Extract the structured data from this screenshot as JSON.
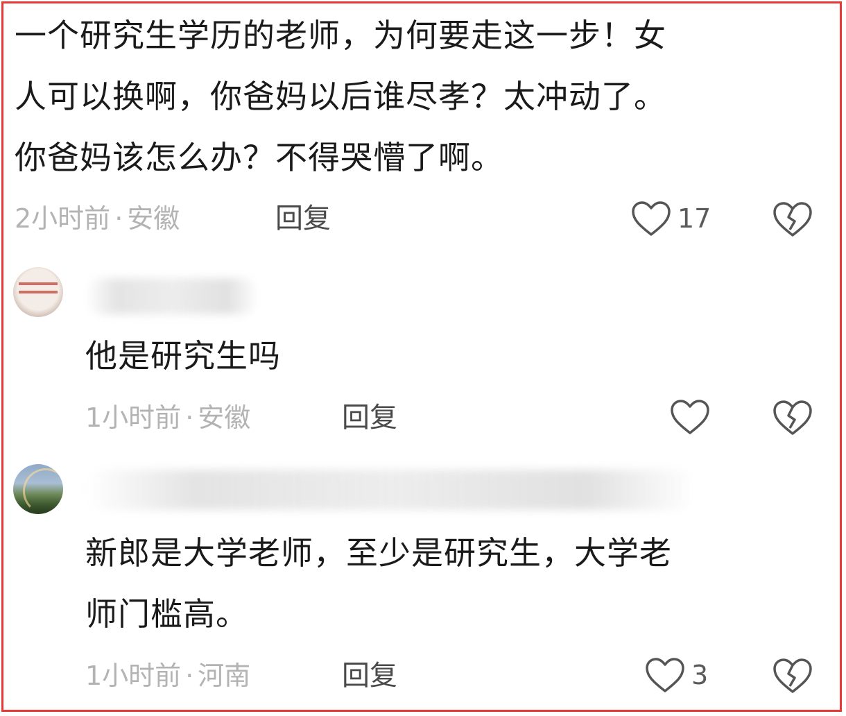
{
  "comments": [
    {
      "lines": [
        "一个研究生学历的老师，为何要走这一步！女",
        "人可以换啊，你爸妈以后谁尽孝？太冲动了。",
        "你爸妈该怎么办？不得哭懵了啊。"
      ],
      "time": "2小时前",
      "location": "安徽",
      "reply_label": "回复",
      "likes": "17"
    },
    {
      "lines": [
        "他是研究生吗"
      ],
      "time": "1小时前",
      "location": "安徽",
      "reply_label": "回复",
      "likes": ""
    },
    {
      "lines": [
        "新郎是大学老师，至少是研究生，大学老",
        "师门槛高。"
      ],
      "time": "1小时前",
      "location": "河南",
      "reply_label": "回复",
      "likes": "3"
    }
  ],
  "meta_separator": "·",
  "icons": {
    "like": "heart-outline-icon",
    "dislike": "broken-heart-icon"
  },
  "colors": {
    "border": "#e53935",
    "text": "#1a1a1a",
    "meta": "#b3b3b3",
    "icon": "#555555"
  }
}
